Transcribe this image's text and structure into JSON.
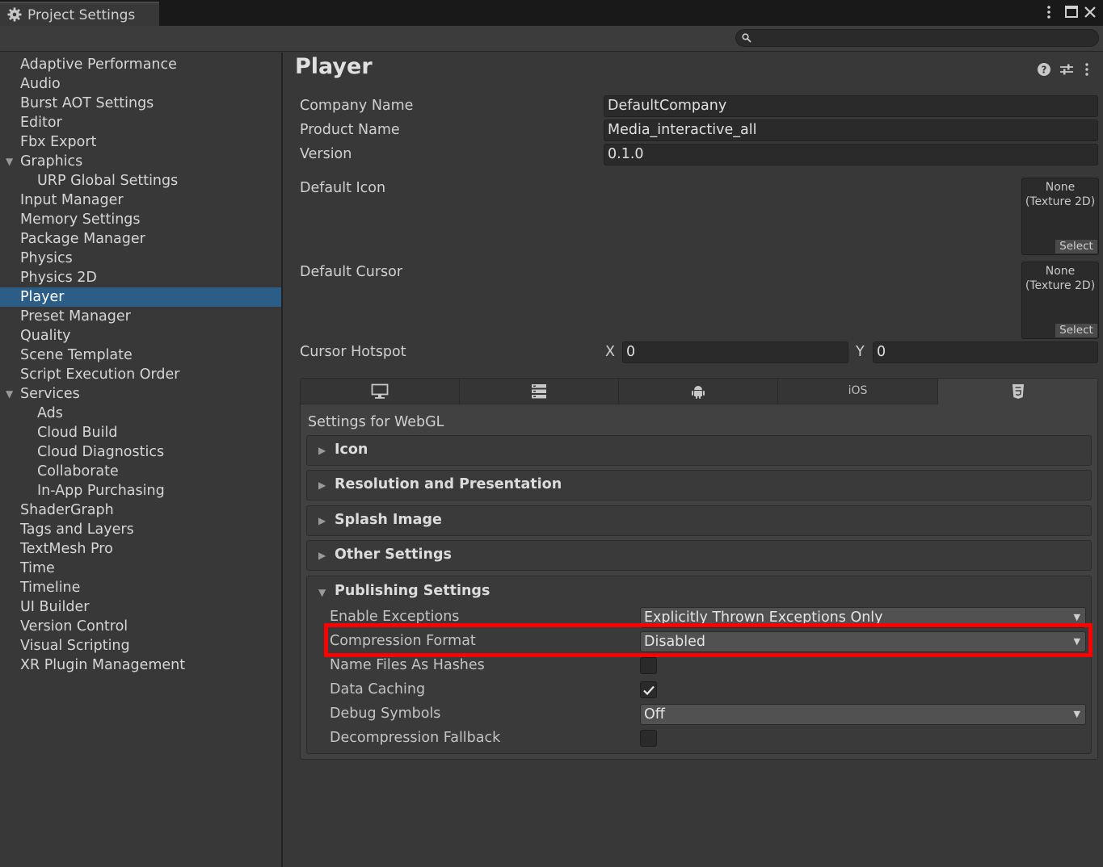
{
  "window": {
    "title": "Project Settings",
    "search_placeholder": ""
  },
  "sidebar": {
    "items": [
      {
        "label": "Adaptive Performance"
      },
      {
        "label": "Audio"
      },
      {
        "label": "Burst AOT Settings"
      },
      {
        "label": "Editor"
      },
      {
        "label": "Fbx Export"
      },
      {
        "label": "Graphics"
      },
      {
        "label": "URP Global Settings"
      },
      {
        "label": "Input Manager"
      },
      {
        "label": "Memory Settings"
      },
      {
        "label": "Package Manager"
      },
      {
        "label": "Physics"
      },
      {
        "label": "Physics 2D"
      },
      {
        "label": "Player"
      },
      {
        "label": "Preset Manager"
      },
      {
        "label": "Quality"
      },
      {
        "label": "Scene Template"
      },
      {
        "label": "Script Execution Order"
      },
      {
        "label": "Services"
      },
      {
        "label": "Ads"
      },
      {
        "label": "Cloud Build"
      },
      {
        "label": "Cloud Diagnostics"
      },
      {
        "label": "Collaborate"
      },
      {
        "label": "In-App Purchasing"
      },
      {
        "label": "ShaderGraph"
      },
      {
        "label": "Tags and Layers"
      },
      {
        "label": "TextMesh Pro"
      },
      {
        "label": "Time"
      },
      {
        "label": "Timeline"
      },
      {
        "label": "UI Builder"
      },
      {
        "label": "Version Control"
      },
      {
        "label": "Visual Scripting"
      },
      {
        "label": "XR Plugin Management"
      }
    ],
    "selected": "Player"
  },
  "player": {
    "title": "Player",
    "company_name": {
      "label": "Company Name",
      "value": "DefaultCompany"
    },
    "product_name": {
      "label": "Product Name",
      "value": "Media_interactive_all"
    },
    "version": {
      "label": "Version",
      "value": "0.1.0"
    },
    "default_icon": {
      "label": "Default Icon",
      "line1": "None",
      "line2": "(Texture 2D)",
      "select": "Select"
    },
    "default_cursor": {
      "label": "Default Cursor",
      "line1": "None",
      "line2": "(Texture 2D)",
      "select": "Select"
    },
    "cursor_hotspot": {
      "label": "Cursor Hotspot",
      "x_label": "X",
      "x_value": "0",
      "y_label": "Y",
      "y_value": "0"
    }
  },
  "platform_tabs": [
    {
      "name": "standalone",
      "icon": "monitor-icon"
    },
    {
      "name": "server",
      "icon": "server-icon"
    },
    {
      "name": "android",
      "icon": "android-icon"
    },
    {
      "name": "ios",
      "label": "iOS"
    },
    {
      "name": "webgl",
      "icon": "html5-icon",
      "active": true
    }
  ],
  "settings_for": "Settings for WebGL",
  "sections": {
    "icon": "Icon",
    "resolution": "Resolution and Presentation",
    "splash": "Splash Image",
    "other": "Other Settings",
    "publishing": "Publishing Settings"
  },
  "publishing": {
    "enable_exceptions": {
      "label": "Enable Exceptions",
      "value": "Explicitly Thrown Exceptions Only"
    },
    "compression_format": {
      "label": "Compression Format",
      "value": "Disabled"
    },
    "name_files_as_hashes": {
      "label": "Name Files As Hashes",
      "checked": false
    },
    "data_caching": {
      "label": "Data Caching",
      "checked": true
    },
    "debug_symbols": {
      "label": "Debug Symbols",
      "value": "Off"
    },
    "decompression_fallback": {
      "label": "Decompression Fallback",
      "checked": false
    }
  },
  "colors": {
    "selection": "#2c5d87",
    "highlight": "#ff0000",
    "background": "#383838"
  }
}
